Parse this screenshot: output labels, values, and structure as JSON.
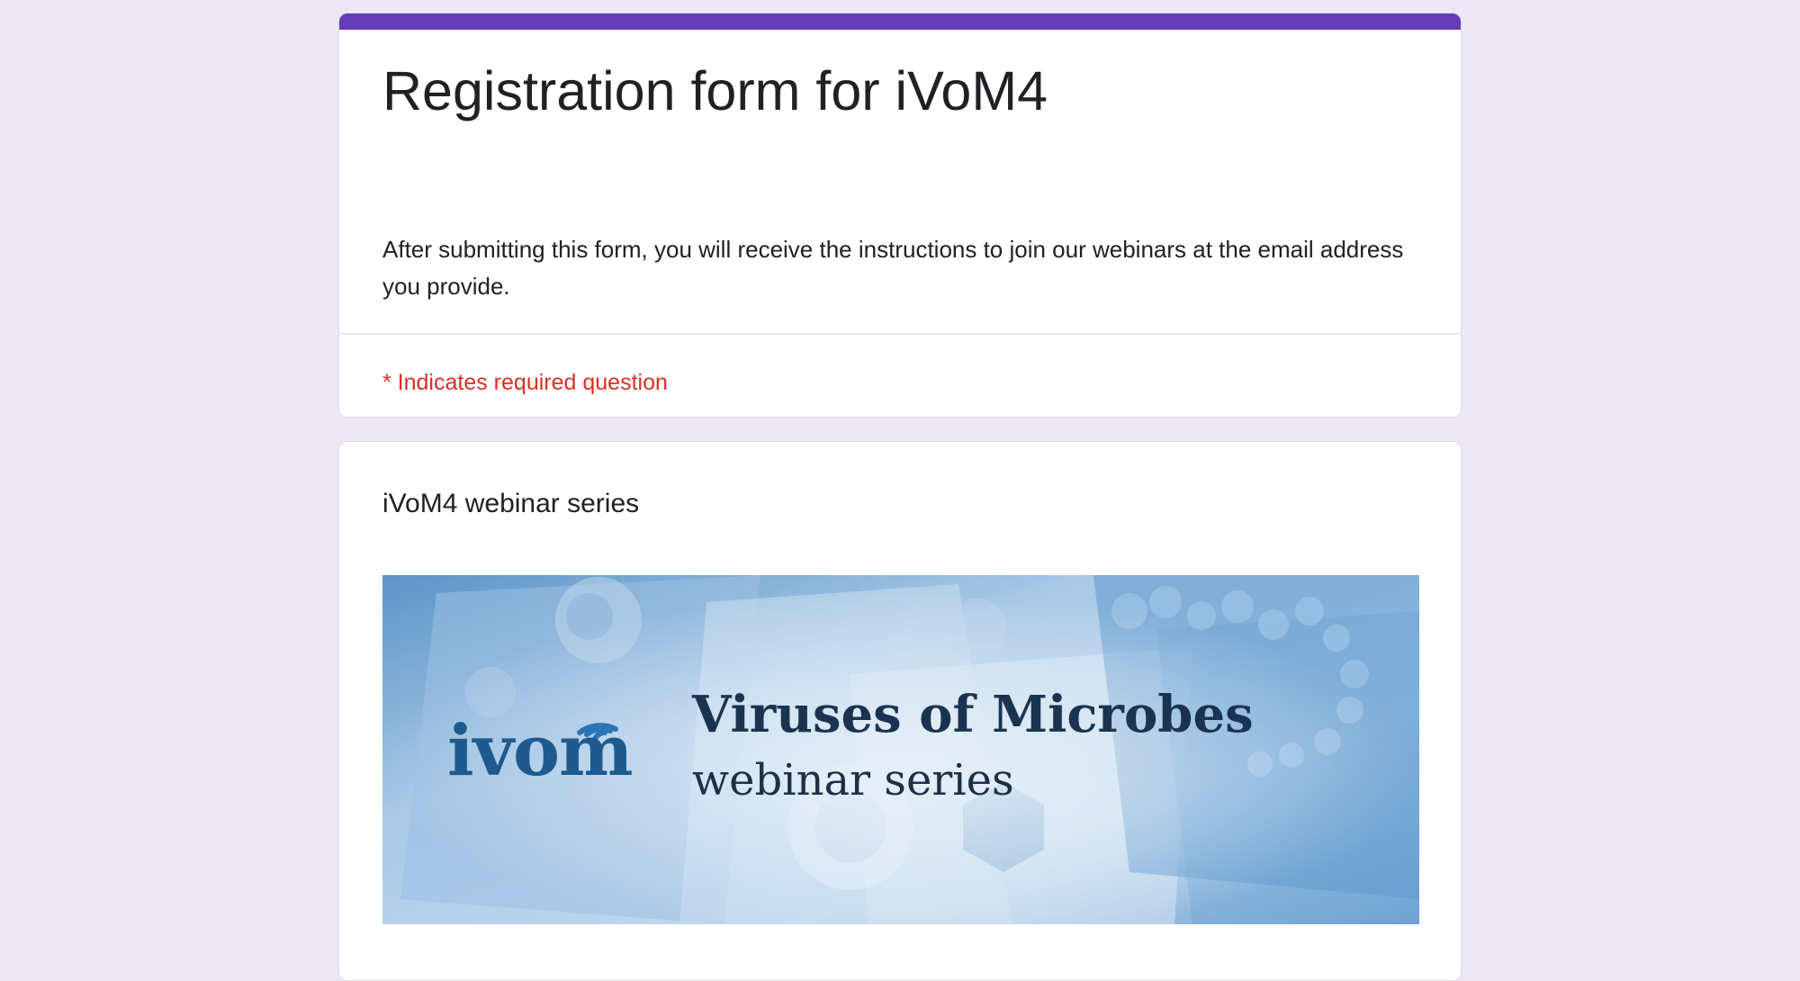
{
  "form": {
    "title": "Registration form for iVoM4",
    "description": "After submitting this form, you will receive the instructions to join our webinars at the email address you provide.",
    "required_note": "* Indicates required question",
    "accent_color": "#673ab7",
    "background_color": "#ede7f6",
    "required_color": "#d93025"
  },
  "section": {
    "heading": "iVoM4 webinar series",
    "banner": {
      "brand": "ivom",
      "title": "Viruses of Microbes",
      "subtitle": "webinar series",
      "icon": "wifi-signal-icon"
    }
  }
}
